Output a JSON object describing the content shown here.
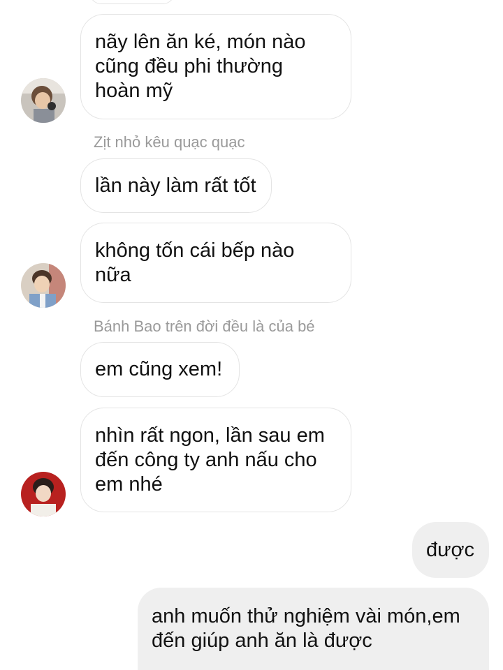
{
  "messages": {
    "m1": "nãy lên ăn ké, món nào\ncũng đều phi thường\nhoàn mỹ",
    "sender2": "Zịt nhỏ kêu quạc quạc",
    "m2": "lần này làm rất tốt",
    "m3": "không tốn cái bếp nào\nnữa",
    "sender4": "Bánh Bao trên đời đều là của bé",
    "m4": "em cũng xem!",
    "m5": "nhìn rất ngon, lần sau em\nđến công ty anh nấu cho\nem nhé",
    "m6": "được",
    "m7": "anh muốn thử nghiệm vài món,em\nđến giúp anh ăn là được"
  },
  "colors": {
    "incoming_bubble_bg": "#ffffff",
    "incoming_bubble_border": "#e4e4e4",
    "outgoing_bubble_bg": "#efefef",
    "sender_text": "#9a9a9a",
    "message_text": "#111111"
  }
}
